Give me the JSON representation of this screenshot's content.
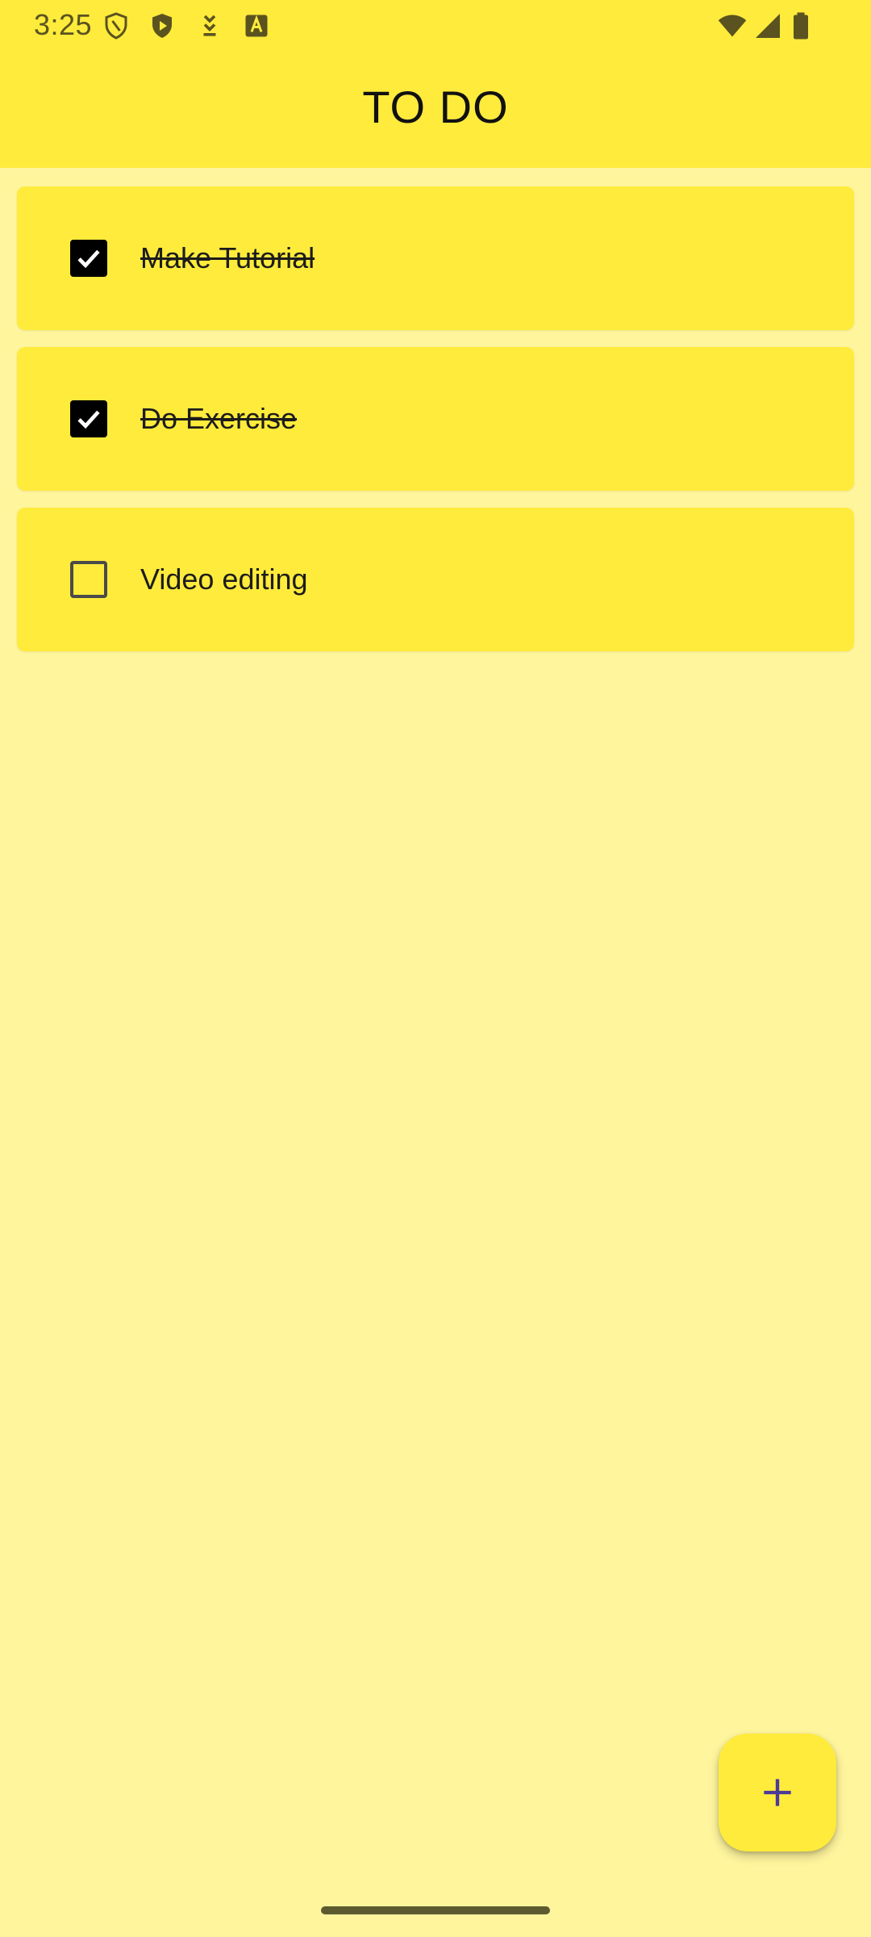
{
  "status_bar": {
    "time": "3:25",
    "left_icons": [
      "privacy-shield-icon",
      "play-protect-icon",
      "download-arrow-icon",
      "text-a-icon"
    ],
    "right_icons": [
      "wifi-icon",
      "cellular-signal-icon",
      "battery-icon"
    ]
  },
  "app_bar": {
    "title": "TO DO",
    "background": "#FFEB3B"
  },
  "colors": {
    "page_background": "#FFF59D",
    "card_background": "#FFEB3B",
    "fab_icon": "#4a3a9a"
  },
  "todos": [
    {
      "label": "Make Tutorial",
      "checked": true
    },
    {
      "label": "Do Exercise",
      "checked": true
    },
    {
      "label": "Video editing",
      "checked": false
    }
  ],
  "fab": {
    "icon": "plus-icon"
  }
}
